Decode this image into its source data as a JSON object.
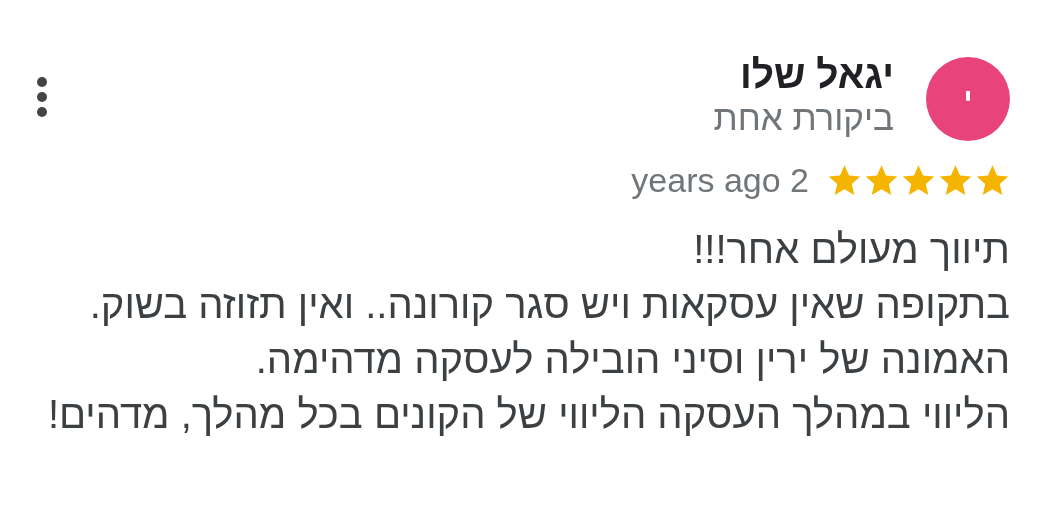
{
  "review": {
    "avatar_letter": "י",
    "color": "#e8437a",
    "author": "יגאל שלו",
    "subtitle": "ביקורת אחת",
    "stars": 5,
    "time": "years ago 2",
    "text_lines": [
      "תיווך מעולם אחר!!!",
      "בתקופה שאין עסקאות ויש סגר קורונה.. ואין תזוזה בשוק.",
      "האמונה של ירין וסיני הובילה לעסקה מדהימה.",
      "הליווי במהלך העסקה הליווי של הקונים בכל מהלך, מדהים!"
    ]
  }
}
